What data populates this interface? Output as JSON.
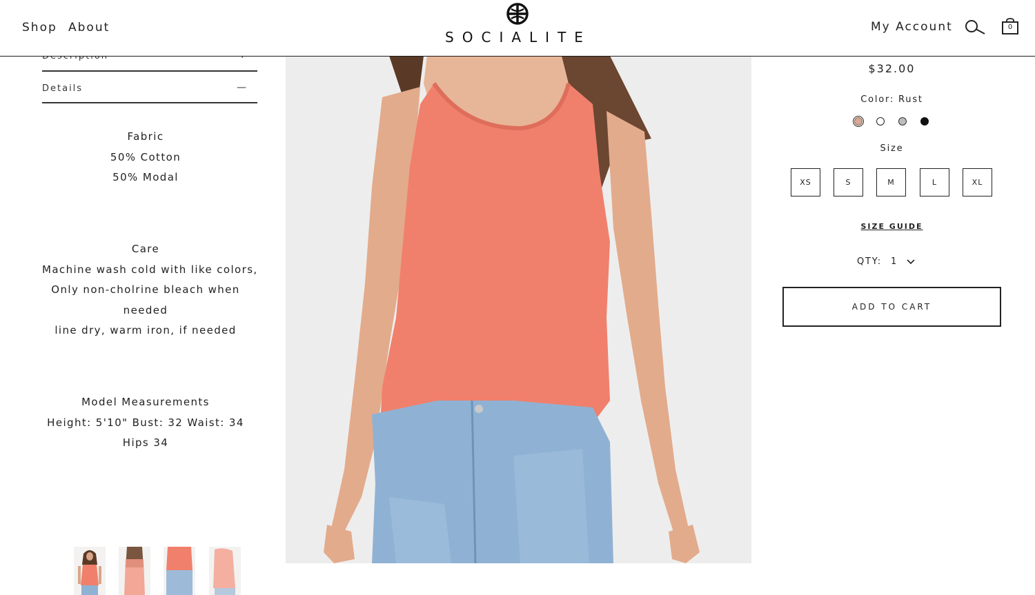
{
  "header": {
    "nav": [
      "Shop",
      "About"
    ],
    "logo_text": "SOCIALITE",
    "account_label": "My Account",
    "cart_count": "0",
    "icons": [
      "logo-mark",
      "search-icon",
      "shopping-bag-icon"
    ]
  },
  "details": {
    "description_label": "Description",
    "description_toggle": "+",
    "details_label": "Details",
    "details_toggle": "—",
    "fabric": {
      "title": "Fabric",
      "lines": [
        "50% Cotton",
        "50% Modal"
      ]
    },
    "care": {
      "title": "Care",
      "lines": [
        "Machine wash cold with like colors,",
        "Only non-cholrine bleach when",
        "needed",
        "line dry, warm iron, if needed"
      ]
    },
    "model": {
      "title": "Model Measurements",
      "lines": [
        "Height: 5'10\"   Bust: 32  Waist: 34",
        "Hips 34"
      ]
    }
  },
  "product": {
    "price": "$32.00",
    "color_label": "Color: Rust",
    "swatches": [
      {
        "name": "Rust",
        "hex": "#d9a795",
        "selected": true
      },
      {
        "name": "White",
        "hex": "#ffffff",
        "selected": false
      },
      {
        "name": "Grey",
        "hex": "#bdbdbd",
        "selected": false
      },
      {
        "name": "Black",
        "hex": "#111111",
        "selected": false
      }
    ],
    "size_label": "Size",
    "sizes": [
      "XS",
      "S",
      "M",
      "L",
      "XL"
    ],
    "size_guide": "SIZE GUIDE",
    "qty_label": "QTY:",
    "qty_value": "1",
    "add_to_cart": "ADD TO CART"
  },
  "colors": {
    "top_coral": "#f0806c",
    "denim": "#8fb2d4",
    "background": "#eeeded"
  }
}
